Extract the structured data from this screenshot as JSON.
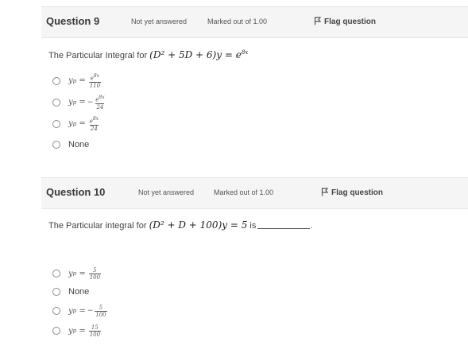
{
  "q9": {
    "number_label": "Question 9",
    "status": "Not yet answered",
    "marks": "Marked out of 1.00",
    "flag_label": "Flag question",
    "text_prefix": "The Particular Integral for ",
    "equation_lhs": "(D² + 5D + 6)y",
    "equation_rhs": "e",
    "equation_exp": "8x",
    "options": [
      {
        "lhs": "y",
        "sub": "p",
        "sign": "",
        "num": "e^8x",
        "den": "110"
      },
      {
        "lhs": "y",
        "sub": "p",
        "sign": "−",
        "num": "e^8x",
        "den": "24"
      },
      {
        "lhs": "y",
        "sub": "p",
        "sign": "",
        "num": "e^8x",
        "den": "24"
      },
      {
        "label": "None"
      }
    ]
  },
  "q10": {
    "number_label": "Question 10",
    "status": "Not yet answered",
    "marks": "Marked out of 1.00",
    "flag_label": "Flag question",
    "text_prefix": "The Particular integral for ",
    "equation": "(D² + D + 100)y = 5",
    "text_suffix": " is",
    "text_end": ".",
    "options": [
      {
        "lhs": "y",
        "sub": "p",
        "sign": "",
        "num": "5",
        "den": "100"
      },
      {
        "label": "None"
      },
      {
        "lhs": "y",
        "sub": "p",
        "sign": "−",
        "num": "5",
        "den": "100"
      },
      {
        "lhs": "y",
        "sub": "p",
        "sign": "",
        "num": "15",
        "den": "100"
      }
    ]
  }
}
